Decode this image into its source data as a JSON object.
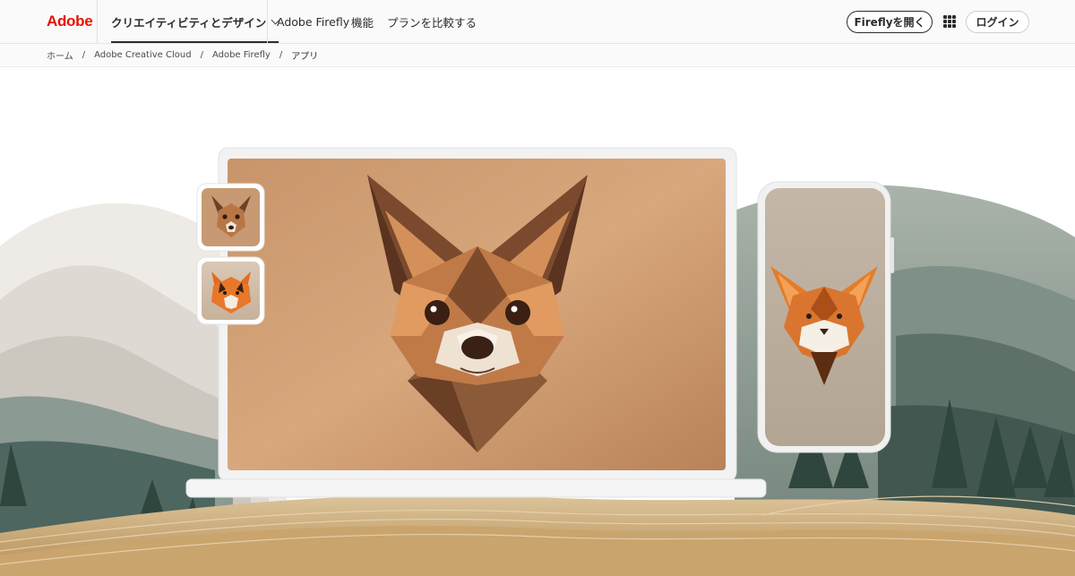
{
  "header": {
    "logo_text": "Adobe",
    "nav": [
      {
        "label": "クリエイティビティとデザイン",
        "active": true,
        "has_dropdown": true
      },
      {
        "label": "Adobe Firefly"
      },
      {
        "label": "機能"
      },
      {
        "label": "プランを比較する"
      }
    ],
    "open_firefly_label": "Fireflyを開く",
    "apps_icon": "apps-grid-icon",
    "login_label": "ログイン"
  },
  "breadcrumb": {
    "items": [
      "ホーム",
      "Adobe Creative Cloud",
      "Adobe Firefly"
    ],
    "separator": "/",
    "current": "アプリ"
  },
  "hero": {
    "thumbnails": [
      "chihuahua-thumbnail",
      "tiger-thumbnail"
    ],
    "laptop_image": "origami-chihuahua",
    "phone_image": "origami-lynx"
  },
  "colors": {
    "brand": "#eb1000",
    "text": "#2c2c2c"
  }
}
